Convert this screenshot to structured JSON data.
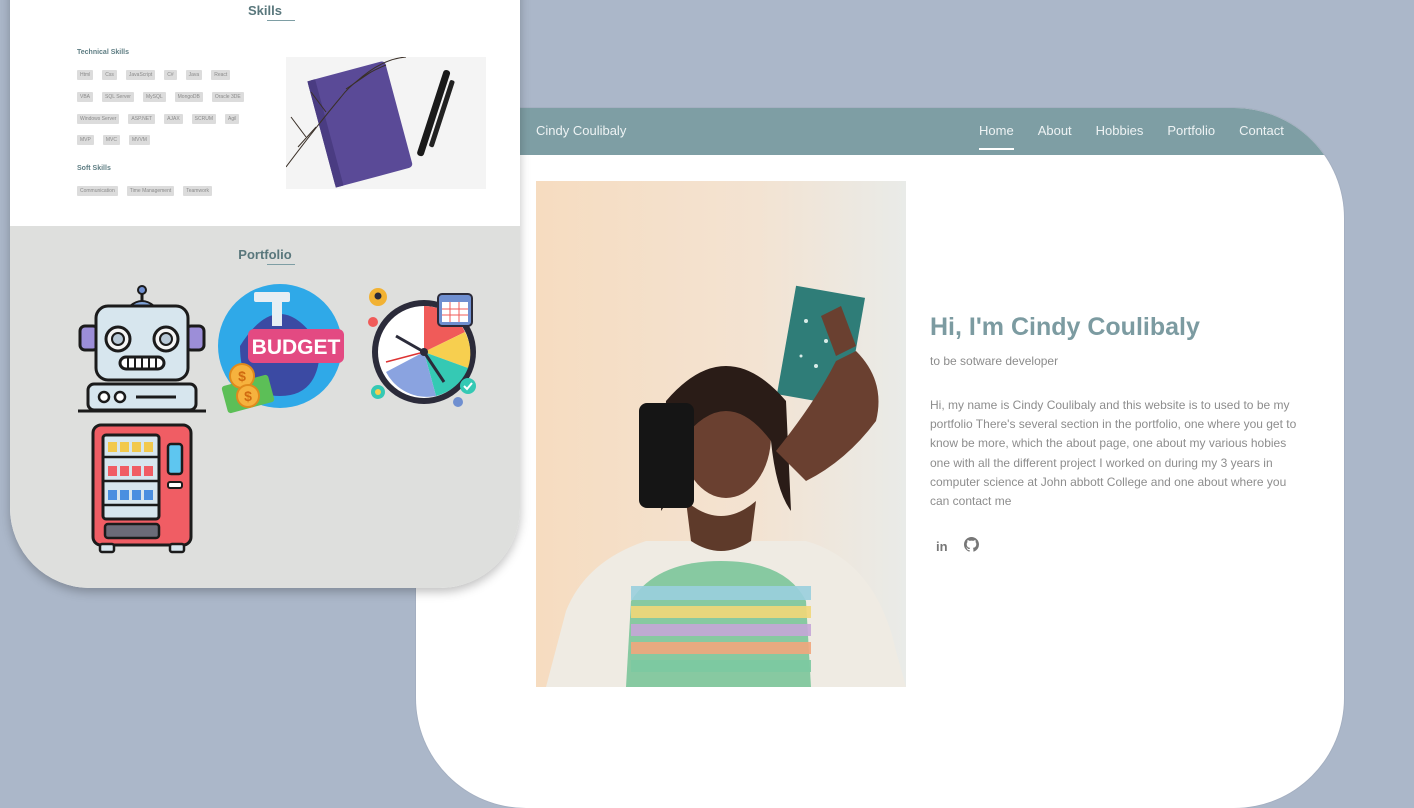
{
  "home": {
    "brand": "Cindy Coulibaly",
    "nav": [
      {
        "label": "Home"
      },
      {
        "label": "About"
      },
      {
        "label": "Hobbies"
      },
      {
        "label": "Portfolio"
      },
      {
        "label": "Contact"
      }
    ],
    "hero_title": "Hi, I'm Cindy Coulibaly",
    "hero_subtitle": "to be sotware developer",
    "hero_description": "Hi, my name is Cindy Coulibaly and this website is to used to be my portfolio There's several section in the portfolio, one where you get to know be more, which the about page, one about my various hobies one with all the different project I worked on during my 3 years in computer science at John abbott College and one about where you can contact me",
    "socials": [
      {
        "label": "in",
        "icon": "linkedin-icon"
      },
      {
        "label": "",
        "icon": "github-icon"
      }
    ]
  },
  "skills": {
    "title": "Skills",
    "technical_title": "Technical Skills",
    "technical_rows": [
      [
        "Html",
        "Css",
        "JavaScript",
        "C#",
        "Java",
        "React"
      ],
      [
        "VBA",
        "SQL Server",
        "MySQL",
        "MongoDB",
        "Oracle 3DE"
      ],
      [
        "Windows Server",
        "ASP.NET",
        "AJAX",
        "SCRUM",
        "Agil"
      ],
      [
        "MVP",
        "MVC",
        "MVVM"
      ]
    ],
    "soft_title": "Soft Skills",
    "soft_row": [
      "Communication",
      "Time Management",
      "Teamwork"
    ]
  },
  "portfolio": {
    "title": "Portfolio",
    "budget_label": "BUDGET",
    "projects": [
      {
        "icon": "robot-icon"
      },
      {
        "icon": "budget-icon"
      },
      {
        "icon": "clock-calendar-icon"
      },
      {
        "icon": "vending-machine-icon"
      }
    ]
  },
  "colors": {
    "background": "#abb7c9",
    "nav": "#7e9ea4",
    "accent": "#7c9ba1",
    "portfolio_bg": "#dedfdd"
  }
}
